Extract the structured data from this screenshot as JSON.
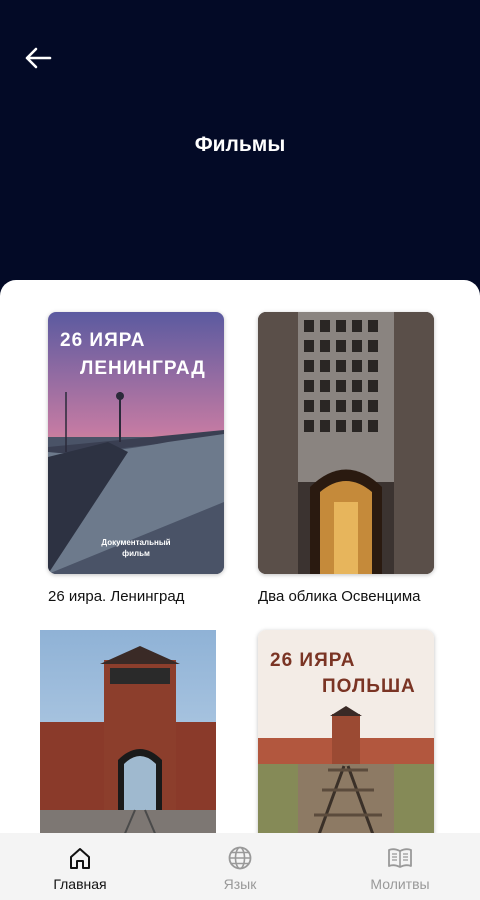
{
  "header": {
    "title": "Фильмы"
  },
  "films": [
    {
      "title": "26 ияра. Ленинград",
      "poster_line1": "26 ИЯРА",
      "poster_line2": "ЛЕНИНГРАД",
      "poster_caption_1": "Документальный",
      "poster_caption_2": "фильм"
    },
    {
      "title": "Два облика Освенцима"
    },
    {
      "title": ""
    },
    {
      "title": "",
      "poster_line1": "26 ИЯРА",
      "poster_line2": "ПОЛЬША"
    }
  ],
  "tabbar": {
    "items": [
      {
        "label": "Главная",
        "icon": "home-icon",
        "active": true
      },
      {
        "label": "Язык",
        "icon": "globe-icon",
        "active": false
      },
      {
        "label": "Молитвы",
        "icon": "book-icon",
        "active": false
      }
    ]
  },
  "colors": {
    "header_bg": "#030a26",
    "active_tab": "#111111",
    "inactive_tab": "#999999"
  }
}
